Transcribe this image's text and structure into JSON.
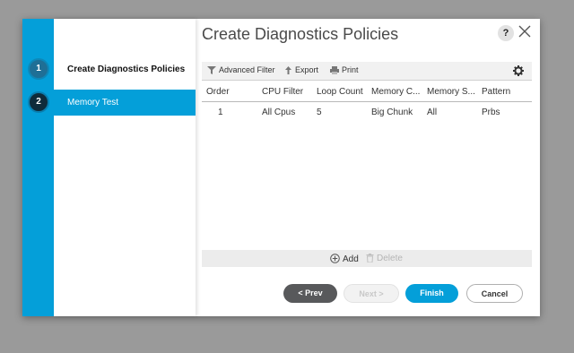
{
  "wizard": {
    "steps": [
      {
        "number": "1",
        "label": "Create Diagnostics Policies"
      },
      {
        "number": "2",
        "label": "Memory Test"
      }
    ]
  },
  "dialog": {
    "title": "Create Diagnostics Policies",
    "help_label": "?"
  },
  "toolbar": {
    "advanced_filter": "Advanced Filter",
    "export": "Export",
    "print": "Print"
  },
  "table": {
    "columns": [
      "Order",
      "CPU Filter",
      "Loop Count",
      "Memory C...",
      "Memory S...",
      "Pattern"
    ],
    "rows": [
      [
        "1",
        "All Cpus",
        "5",
        "Big Chunk",
        "All",
        "Prbs"
      ]
    ]
  },
  "row_actions": {
    "add": "Add",
    "delete": "Delete"
  },
  "footer": {
    "prev": "< Prev",
    "next": "Next >",
    "finish": "Finish",
    "cancel": "Cancel"
  },
  "colors": {
    "accent": "#049fd9",
    "prev_button": "#58595b"
  }
}
